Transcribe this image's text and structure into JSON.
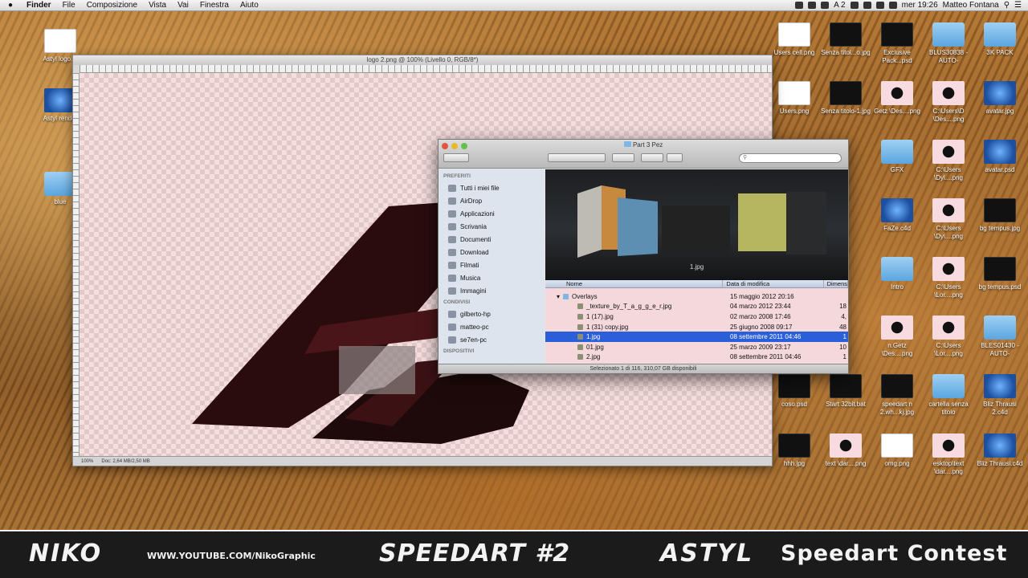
{
  "menubar": {
    "apple": "",
    "items": [
      "Finder",
      "File",
      "Composizione",
      "Vista",
      "Vai",
      "Finestra",
      "Aiuto"
    ],
    "status_letter": "A 2",
    "clock": "mer 19:26",
    "user": "Matteo Fontana"
  },
  "photoshop": {
    "title": "logo 2.png @ 100% (Livello 0, RGB/8*)",
    "zoom": "100%",
    "doc_info": "Doc: 2,64 MB/2,50 MB"
  },
  "finder": {
    "title": "Part 3 Pez",
    "sidebar": {
      "favorites_header": "PREFERITI",
      "favorites": [
        {
          "label": "Tutti i miei file",
          "icon": "all-files-icon"
        },
        {
          "label": "AirDrop",
          "icon": "airdrop-icon"
        },
        {
          "label": "Applicazioni",
          "icon": "applications-icon"
        },
        {
          "label": "Scrivania",
          "icon": "desktop-icon"
        },
        {
          "label": "Documenti",
          "icon": "documents-icon"
        },
        {
          "label": "Download",
          "icon": "download-icon"
        },
        {
          "label": "Filmati",
          "icon": "movies-icon"
        },
        {
          "label": "Musica",
          "icon": "music-icon"
        },
        {
          "label": "Immagini",
          "icon": "pictures-icon"
        }
      ],
      "shared_header": "CONDIVISI",
      "shared": [
        {
          "label": "gilberto-hp",
          "icon": "computer-icon"
        },
        {
          "label": "matteo-pc",
          "icon": "computer-icon"
        },
        {
          "label": "se7en-pc",
          "icon": "computer-icon"
        }
      ],
      "devices_header": "DISPOSITIVI"
    },
    "preview_label": "1.jpg",
    "columns": {
      "name": "Nome",
      "date": "Data di modifica",
      "size": "Dimens"
    },
    "rows": [
      {
        "name": "Overlays",
        "date": "15 maggio 2012 20:16",
        "size": "",
        "folder": true,
        "selected": false
      },
      {
        "name": "_texture_by_T_a_g_g_e_r.jpg",
        "date": "04 marzo 2012 23:44",
        "size": "18",
        "folder": false,
        "selected": false
      },
      {
        "name": "1 (17).jpg",
        "date": "02 marzo 2008 17:46",
        "size": "4,",
        "folder": false,
        "selected": false
      },
      {
        "name": "1 (31) copy.jpg",
        "date": "25 giugno 2008 09:17",
        "size": "48",
        "folder": false,
        "selected": false
      },
      {
        "name": "1.jpg",
        "date": "08 settembre 2011 04:46",
        "size": "1",
        "folder": false,
        "selected": true
      },
      {
        "name": "01.jpg",
        "date": "25 marzo 2009 23:17",
        "size": "10",
        "folder": false,
        "selected": false
      },
      {
        "name": "2.jpg",
        "date": "08 settembre 2011 04:46",
        "size": "1",
        "folder": false,
        "selected": false
      }
    ],
    "status": "Selezionato 1 di 116, 310,07 GB disponibili"
  },
  "desktop_icons_left": [
    {
      "label": "Astyl logo.ai",
      "style": "white"
    },
    {
      "label": "Astyl render",
      "style": "blue"
    },
    {
      "label": "blue",
      "style": "folder"
    }
  ],
  "desktop_icons_right": [
    {
      "label": "Users cell.png",
      "style": "white"
    },
    {
      "label": "Senza titol...o.jpg",
      "style": "dark"
    },
    {
      "label": "Exclusive Pack...psd",
      "style": "dark"
    },
    {
      "label": "BLUS30838 -AUTO-",
      "style": "folder"
    },
    {
      "label": "3K PACK",
      "style": "folder"
    },
    {
      "label": "Users.png",
      "style": "white"
    },
    {
      "label": "Senza titolo-1.jpg",
      "style": "dark"
    },
    {
      "label": "Getz \\Des....png",
      "style": "pinkcirc"
    },
    {
      "label": "C:\\Users\\D \\Des....png",
      "style": "pinkcirc"
    },
    {
      "label": "avatar.jpg",
      "style": "blue"
    },
    {
      "label": "GFX",
      "style": "folder"
    },
    {
      "label": "C:\\Users \\Dyl....png",
      "style": "pinkcirc"
    },
    {
      "label": "avatar.psd",
      "style": "blue"
    },
    {
      "label": "FaZe.c4d",
      "style": "blue"
    },
    {
      "label": "C:\\Users \\Dyl....png",
      "style": "pinkcirc"
    },
    {
      "label": "bg tempus.jpg",
      "style": "dark"
    },
    {
      "label": "Intro",
      "style": "folder"
    },
    {
      "label": "C:\\Users \\Lor....png",
      "style": "pinkcirc"
    },
    {
      "label": "bg tempus.psd",
      "style": "dark"
    },
    {
      "label": "n.Getz \\Des....png",
      "style": "pinkcirc"
    },
    {
      "label": "C:\\Users \\Lor....png",
      "style": "pinkcirc"
    },
    {
      "label": "BLES01430 -AUTO-",
      "style": "folder"
    },
    {
      "label": "coso.psd",
      "style": "dark"
    },
    {
      "label": "Start 32bit.bat",
      "style": "dark"
    },
    {
      "label": "speedart n 2.wh...kj.jpg",
      "style": "dark"
    },
    {
      "label": "cartella senza titolo",
      "style": "folder"
    },
    {
      "label": "Bliz Thrausi 2.c4d",
      "style": "blue"
    },
    {
      "label": "hhh.jpg",
      "style": "dark"
    },
    {
      "label": "text \\dar....png",
      "style": "pinkcirc"
    },
    {
      "label": "omg.png",
      "style": "white"
    },
    {
      "label": "esktop\\text \\dar....png",
      "style": "pinkcirc"
    },
    {
      "label": "Bliz Thrausi.c4d",
      "style": "blue"
    }
  ],
  "banner": {
    "author": "NIKO",
    "url": "WWW.YOUTUBE.COM/NikoGraphic",
    "title": "SPEEDART #2",
    "brand": "ASTYL",
    "contest": "Speedart Contest"
  },
  "colors": {
    "selection": "#2b5fd9",
    "banner_bg": "#1b1b1b",
    "logo_dark": "#2a0c0e"
  }
}
